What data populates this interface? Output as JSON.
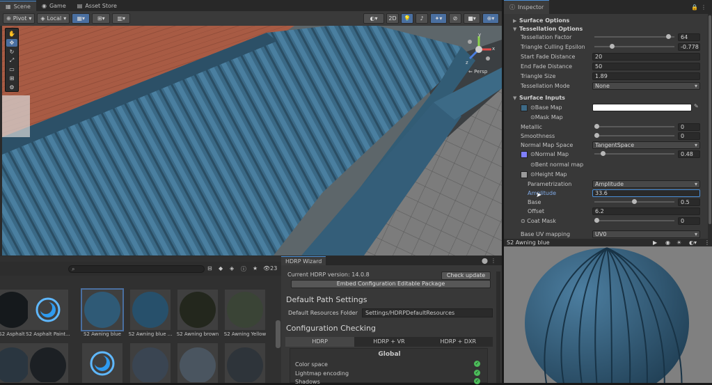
{
  "scene": {
    "tabs": [
      {
        "label": "Scene",
        "icon": "grid-icon"
      },
      {
        "label": "Game",
        "icon": "gamepad-icon"
      },
      {
        "label": "Asset Store",
        "icon": "store-icon"
      }
    ],
    "toolbar": {
      "pivot_label": "Pivot",
      "local_label": "Local",
      "mode_2d_label": "2D"
    },
    "gizmo": {
      "persp_label": "Persp",
      "axis_y": "y",
      "axis_x": "x",
      "axis_z": "z"
    }
  },
  "inspector": {
    "tab_label": "Inspector",
    "sections": {
      "surface_options": "Surface Options",
      "tessellation_options": "Tessellation Options",
      "surface_inputs": "Surface Inputs"
    },
    "tessellation": {
      "factor_label": "Tessellation Factor",
      "factor_value": "64",
      "factor_fill": 0.95,
      "epsilon_label": "Triangle Culling Epsilon",
      "epsilon_value": "-0.778",
      "epsilon_fill": 0.2,
      "start_fade_label": "Start Fade Distance",
      "start_fade_value": "20",
      "end_fade_label": "End Fade Distance",
      "end_fade_value": "50",
      "triangle_size_label": "Triangle Size",
      "triangle_size_value": "1.89",
      "mode_label": "Tessellation Mode",
      "mode_value": "None"
    },
    "inputs": {
      "base_map_label": "Base Map",
      "base_map_color": "#ffffff",
      "base_swatch_color": "#3d6a86",
      "mask_map_label": "Mask Map",
      "metallic_label": "Metallic",
      "metallic_value": "0",
      "metallic_fill": 0.0,
      "smoothness_label": "Smoothness",
      "smoothness_value": "0",
      "smoothness_fill": 0.0,
      "normal_space_label": "Normal Map Space",
      "normal_space_value": "TangentSpace",
      "normal_map_label": "Normal Map",
      "normal_map_value": "0.48",
      "normal_fill": 0.08,
      "normal_swatch_color": "#7f7fff",
      "bent_normal_label": "Bent normal map",
      "height_map_label": "Height Map",
      "height_swatch_color": "#9a9a9a",
      "parametrization_label": "Parametrization",
      "parametrization_value": "Amplitude",
      "amplitude_label": "Amplitude",
      "amplitude_value": "33.6",
      "base_label": "Base",
      "base_value": "0.5",
      "base_fill": 0.5,
      "offset_label": "Offset",
      "offset_value": "6.2",
      "coat_mask_label": "Coat Mask",
      "coat_mask_value": "0",
      "coat_fill": 0.0,
      "uv_mapping_label": "Base UV mapping",
      "uv_mapping_value": "UV0"
    }
  },
  "preview": {
    "title": "S2 Awning blue"
  },
  "project": {
    "count": "23",
    "assets": [
      {
        "label": "S2 Asphalt",
        "type": "dark"
      },
      {
        "label": "S2 Asphalt Paint...",
        "type": "icon"
      },
      {
        "label": "S2 Awning blue",
        "type": "blue"
      },
      {
        "label": "S2 Awning blue ...",
        "type": "blue2"
      },
      {
        "label": "S2 Awning brown",
        "type": "brown"
      },
      {
        "label": "S2 Awning Yellow",
        "type": "yellow"
      }
    ]
  },
  "hdrp": {
    "tab_label": "HDRP Wizard",
    "version_label": "Current HDRP version: 14.0.8",
    "check_update_label": "Check update",
    "embed_label": "Embed Configuration Editable Package",
    "default_path_title": "Default Path Settings",
    "resources_label": "Default Resources Folder",
    "resources_value": "Settings/HDRPDefaultResources",
    "config_title": "Configuration Checking",
    "tabs": [
      "HDRP",
      "HDRP + VR",
      "HDRP + DXR"
    ],
    "global_label": "Global",
    "checks": [
      "Color space",
      "Lightmap encoding",
      "Shadows"
    ]
  },
  "colors": {
    "accent": "#4a90d9",
    "awning": "#3f6a85",
    "check": "#4cbb5a"
  }
}
